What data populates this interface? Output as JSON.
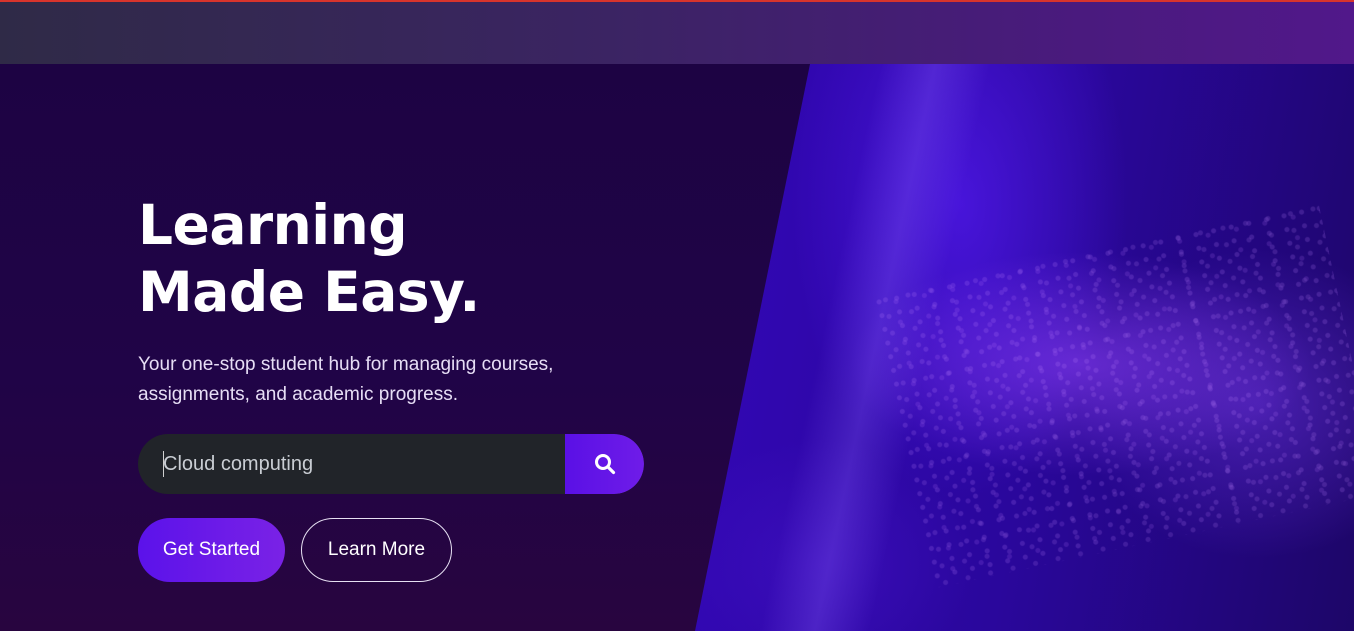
{
  "hero": {
    "headline": "Learning Made Easy.",
    "subtitle": "Your one-stop student hub for managing courses, assignments, and academic progress.",
    "search": {
      "value": "Cloud computing",
      "button_icon": "search-icon"
    },
    "buttons": {
      "primary_label": "Get Started",
      "secondary_label": "Learn More"
    }
  },
  "colors": {
    "accent": "#5b12ea",
    "top_bar": "#d8342c",
    "background": "#1e0545",
    "search_field": "#212429"
  }
}
